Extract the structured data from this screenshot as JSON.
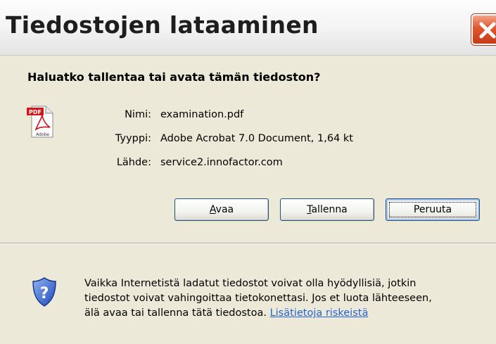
{
  "dialog": {
    "title": "Tiedostojen lataaminen",
    "close_symbol": "✕",
    "question": "Haluatko tallentaa tai avata tämän tiedoston?",
    "file_icon": "pdf-file-icon",
    "pdf_badge": "PDF",
    "pdf_brand": "Adobe",
    "info": {
      "name_label": "Nimi:",
      "name_value": "examination.pdf",
      "type_label": "Tyyppi:",
      "type_value": "Adobe Acrobat 7.0 Document, 1,64 kt",
      "source_label": "Lähde:",
      "source_value": "service2.innofactor.com"
    },
    "buttons": {
      "open_accel": "A",
      "open_rest": "vaa",
      "save_accel": "T",
      "save_rest": "allenna",
      "cancel": "Peruuta"
    },
    "warning": {
      "icon": "security-shield-question-icon",
      "line1": "Vaikka Internetistä ladatut tiedostot voivat olla hyödyllisiä, jotkin",
      "line2": "tiedostot voivat vahingoittaa tietokonettasi. Jos et luota lähteeseen,",
      "line3": "älä avaa tai tallenna tätä tiedostoa.",
      "link": "Lisätietoja riskeistä"
    },
    "colors": {
      "window_bg": "#ece9d8",
      "close_red": "#e0562e",
      "link_blue": "#2463d6",
      "button_border": "#1c5180"
    }
  }
}
